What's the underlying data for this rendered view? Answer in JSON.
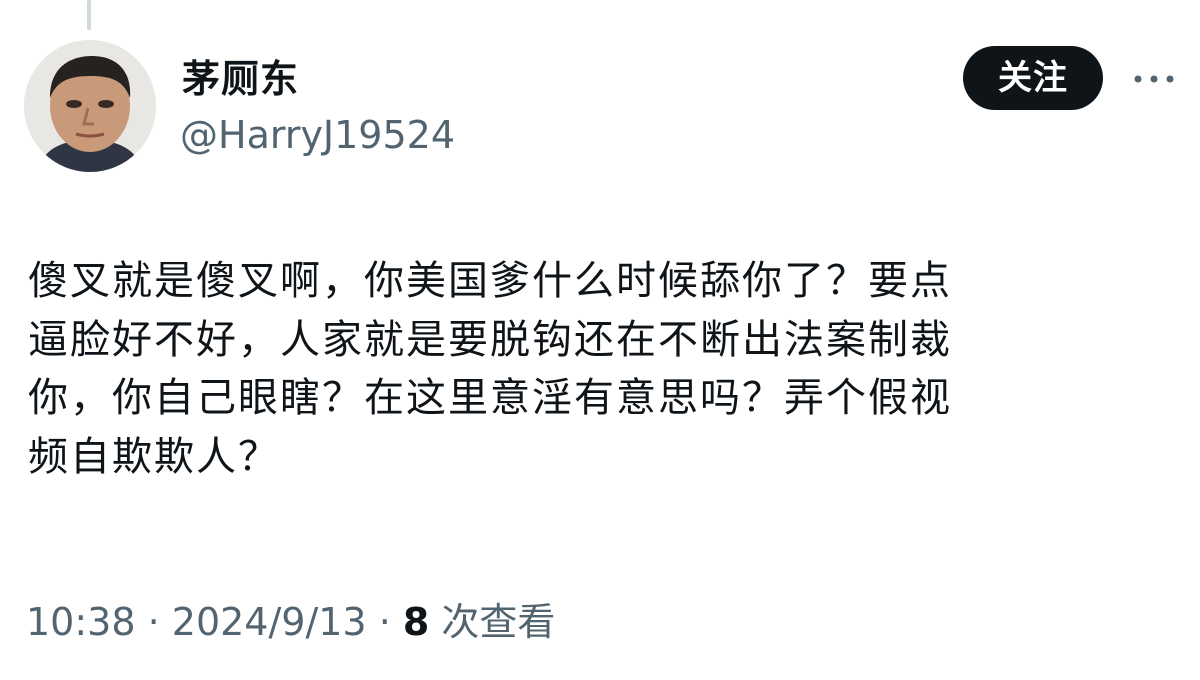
{
  "user": {
    "display_name": "茅厕东",
    "handle": "@HarryJ19524"
  },
  "actions": {
    "follow_label": "关注",
    "more_icon": "more-horizontal-icon"
  },
  "tweet": {
    "lines": [
      "傻叉就是傻叉啊，你美国爹什么时候舔你了？要点",
      "逼脸好不好，人家就是要脱钩还在不断出法案制裁",
      "你，你自己眼瞎？在这里意淫有意思吗？弄个假视",
      "频自欺欺人？"
    ]
  },
  "meta": {
    "time": "10:38",
    "separator": " · ",
    "date": "2024/9/13",
    "views_count": "8",
    "views_label": "次查看"
  },
  "colors": {
    "text": "#0f1419",
    "secondary": "#536471",
    "button_bg": "#0f1419",
    "button_text": "#ffffff",
    "thread_line": "#cfd9de"
  }
}
